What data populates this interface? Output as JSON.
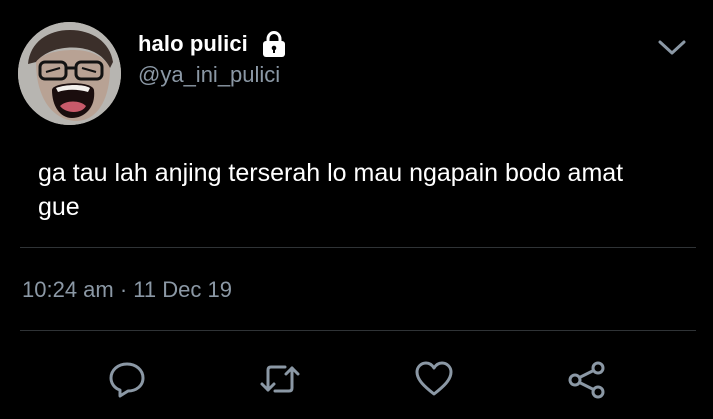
{
  "tweet": {
    "display_name": "halo pulici",
    "handle": "@ya_ini_pulici",
    "protected": true,
    "text": "ga tau lah anjing terserah lo mau ngapain bodo amat gue",
    "timestamp": "10:24 am · 11 Dec 19"
  },
  "icons": {
    "lock": "lock-icon",
    "menu": "chevron-down-icon",
    "reply": "reply-icon",
    "retweet": "retweet-icon",
    "like": "heart-icon",
    "share": "share-icon"
  },
  "colors": {
    "background": "#000000",
    "primary_text": "#ffffff",
    "secondary_text": "#8b98a5",
    "divider": "#2f3336",
    "icon": "#8b98a5"
  }
}
